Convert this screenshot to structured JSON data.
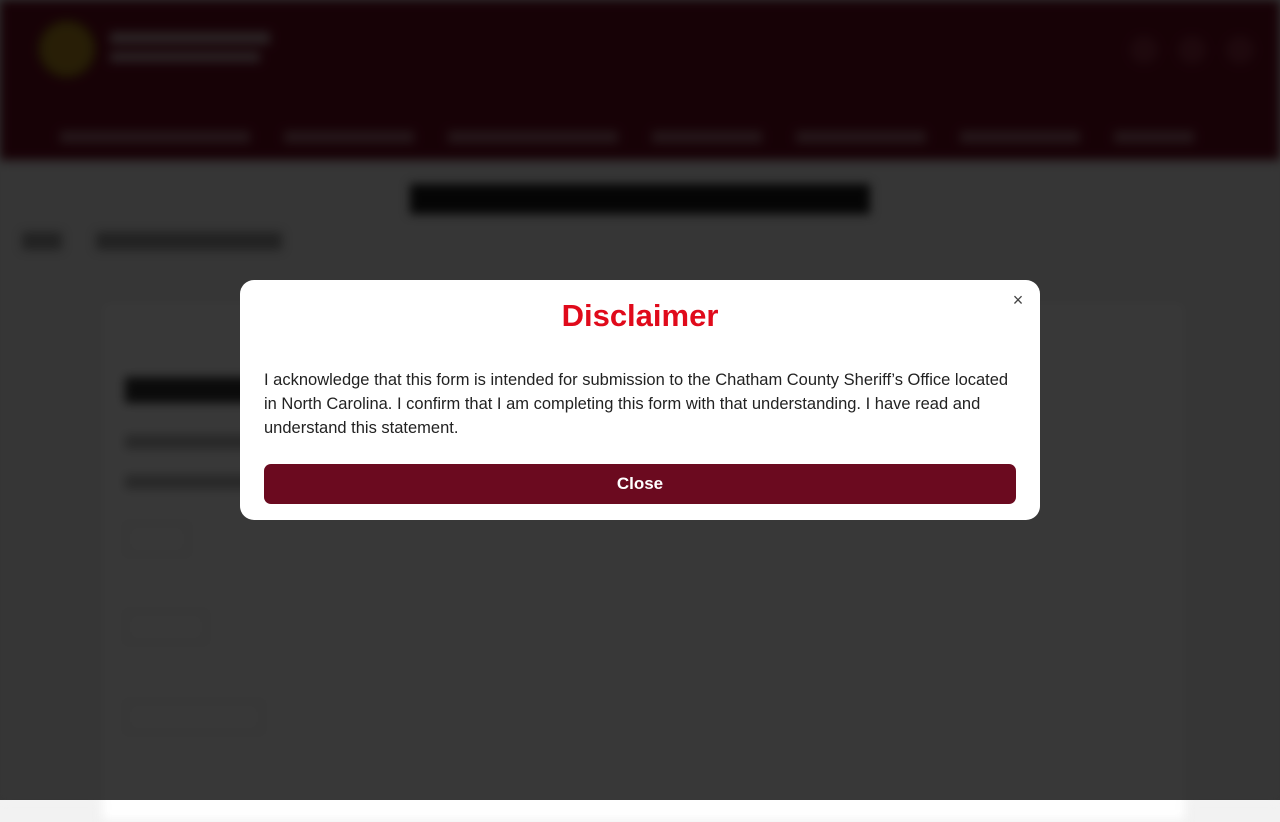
{
  "modal": {
    "title": "Disclaimer",
    "close_icon": "close-icon",
    "close_glyph": "×",
    "body": "I acknowledge that this form is intended for submission to the Chatham County Sheriff’s Office located in North Carolina. I confirm that I am completing this form with that understanding. I have read and understand this statement.",
    "button_label": "Close"
  },
  "colors": {
    "header_bg": "#6b0a1f",
    "title_red": "#e00a1b",
    "button_bg": "#6b0a1f",
    "overlay": "rgba(0,0,0,0.78)"
  }
}
